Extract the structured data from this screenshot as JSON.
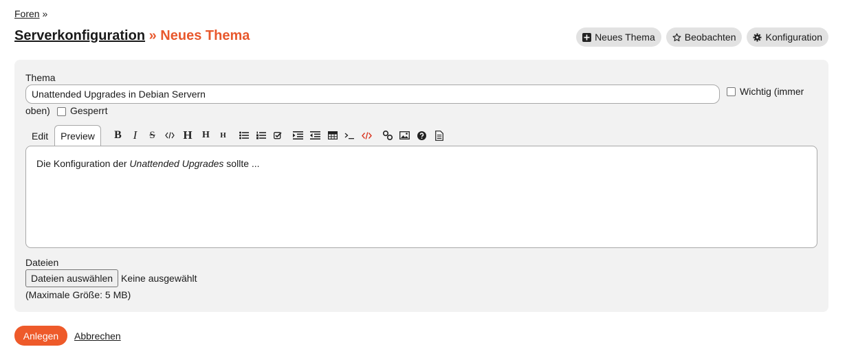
{
  "breadcrumb": {
    "forum_link": "Foren",
    "separator": "»"
  },
  "header": {
    "forum_name": "Serverkonfiguration",
    "separator": "»",
    "page_name": "Neues Thema",
    "actions": [
      {
        "label": "Neues Thema",
        "icon": "plus-square-icon"
      },
      {
        "label": "Beobachten",
        "icon": "star-icon"
      },
      {
        "label": "Konfiguration",
        "icon": "gear-icon"
      }
    ]
  },
  "form": {
    "subject_label": "Thema",
    "subject_value": "Unattended Upgrades in Debian Servern",
    "important_label_1": "Wichtig (immer",
    "important_label_2": "oben)",
    "locked_label": "Gesperrt",
    "tabs": {
      "edit": "Edit",
      "preview": "Preview"
    },
    "toolbar": {
      "bold": "B",
      "italic": "I",
      "strike": "S",
      "heading1": "H",
      "heading2": "H",
      "heading3": "H"
    },
    "preview": {
      "text_before": "Die Konfiguration der ",
      "text_italic": "Unattended Upgrades",
      "text_after": " sollte ..."
    },
    "files_label": "Dateien",
    "file_button": "Dateien auswählen",
    "file_status": "Keine ausgewählt",
    "max_size": "(Maximale Größe: 5 MB)"
  },
  "footer": {
    "submit_label": "Anlegen",
    "cancel_label": "Abbrechen"
  },
  "colors": {
    "accent": "#ee5a2a",
    "title_accent": "#e8582d",
    "panel_bg": "#f2f2f2",
    "pill_bg": "#e2e2e2"
  }
}
